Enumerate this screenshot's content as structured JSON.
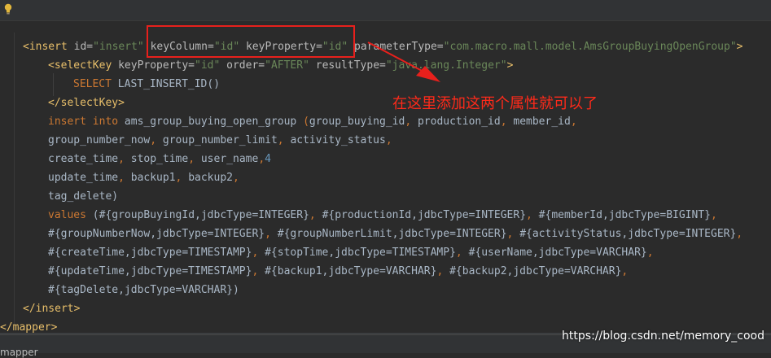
{
  "editor": {
    "lines": [
      [
        {
          "c": "tag",
          "t": "<insert "
        },
        {
          "c": "attr",
          "t": "id="
        },
        {
          "c": "str",
          "t": "\"insert\" "
        },
        {
          "c": "attr",
          "t": "keyColumn="
        },
        {
          "c": "str",
          "t": "\"id\" "
        },
        {
          "c": "attr",
          "t": "keyProperty="
        },
        {
          "c": "str",
          "t": "\"id\" "
        },
        {
          "c": "attr",
          "t": "parameterType="
        },
        {
          "c": "str",
          "t": "\"com.macro.mall.model.AmsGroupBuyingOpenGroup\""
        },
        {
          "c": "tag",
          "t": ">"
        }
      ],
      [
        {
          "c": "tag",
          "t": "<selectKey "
        },
        {
          "c": "attr",
          "t": "keyProperty="
        },
        {
          "c": "str",
          "t": "\"id\" "
        },
        {
          "c": "attr",
          "t": "order="
        },
        {
          "c": "str",
          "t": "\"AFTER\" "
        },
        {
          "c": "attr",
          "t": "resultType="
        },
        {
          "c": "str",
          "t": "\"java.lang.Integer\""
        },
        {
          "c": "tag",
          "t": ">"
        }
      ],
      [
        {
          "c": "kw",
          "t": "SELECT "
        },
        {
          "c": "plain",
          "t": "LAST_INSERT_ID()"
        }
      ],
      [
        {
          "c": "tag",
          "t": "</selectKey>"
        }
      ],
      [
        {
          "c": "kw",
          "t": "insert into "
        },
        {
          "c": "plain",
          "t": "ams_group_buying_open_group "
        },
        {
          "c": "kw",
          "t": "("
        },
        {
          "c": "plain",
          "t": "group_buying_id"
        },
        {
          "c": "kw",
          "t": ", "
        },
        {
          "c": "plain",
          "t": "production_id"
        },
        {
          "c": "kw",
          "t": ", "
        },
        {
          "c": "plain",
          "t": "member_id"
        },
        {
          "c": "kw",
          "t": ","
        }
      ],
      [
        {
          "c": "plain",
          "t": "group_number_now"
        },
        {
          "c": "kw",
          "t": ", "
        },
        {
          "c": "plain",
          "t": "group_number_limit"
        },
        {
          "c": "kw",
          "t": ", "
        },
        {
          "c": "plain",
          "t": "activity_status"
        },
        {
          "c": "kw",
          "t": ","
        }
      ],
      [
        {
          "c": "plain",
          "t": "create_time"
        },
        {
          "c": "kw",
          "t": ", "
        },
        {
          "c": "plain",
          "t": "stop_time"
        },
        {
          "c": "kw",
          "t": ", "
        },
        {
          "c": "plain",
          "t": "user_name"
        },
        {
          "c": "kw",
          "t": ","
        },
        {
          "c": "num",
          "t": "4"
        }
      ],
      [
        {
          "c": "plain",
          "t": "update_time"
        },
        {
          "c": "kw",
          "t": ", "
        },
        {
          "c": "plain",
          "t": "backup1"
        },
        {
          "c": "kw",
          "t": ", "
        },
        {
          "c": "plain",
          "t": "backup2"
        },
        {
          "c": "kw",
          "t": ","
        }
      ],
      [
        {
          "c": "plain",
          "t": "tag_delete)"
        }
      ],
      [
        {
          "c": "kw",
          "t": "values "
        },
        {
          "c": "plain",
          "t": "(#{groupBuyingId,jdbcType=INTEGER}"
        },
        {
          "c": "kw",
          "t": ", "
        },
        {
          "c": "plain",
          "t": "#{productionId,jdbcType=INTEGER}"
        },
        {
          "c": "kw",
          "t": ", "
        },
        {
          "c": "plain",
          "t": "#{memberId,jdbcType=BIGINT}"
        },
        {
          "c": "kw",
          "t": ","
        }
      ],
      [
        {
          "c": "plain",
          "t": "#{groupNumberNow,jdbcType=INTEGER}"
        },
        {
          "c": "kw",
          "t": ", "
        },
        {
          "c": "plain",
          "t": "#{groupNumberLimit,jdbcType=INTEGER}"
        },
        {
          "c": "kw",
          "t": ", "
        },
        {
          "c": "plain",
          "t": "#{activityStatus,jdbcType=INTEGER}"
        },
        {
          "c": "kw",
          "t": ","
        }
      ],
      [
        {
          "c": "plain",
          "t": "#{createTime,jdbcType=TIMESTAMP}"
        },
        {
          "c": "kw",
          "t": ", "
        },
        {
          "c": "plain",
          "t": "#{stopTime,jdbcType=TIMESTAMP}"
        },
        {
          "c": "kw",
          "t": ", "
        },
        {
          "c": "plain",
          "t": "#{userName,jdbcType=VARCHAR}"
        },
        {
          "c": "kw",
          "t": ","
        }
      ],
      [
        {
          "c": "plain",
          "t": "#{updateTime,jdbcType=TIMESTAMP}"
        },
        {
          "c": "kw",
          "t": ", "
        },
        {
          "c": "plain",
          "t": "#{backup1,jdbcType=VARCHAR}"
        },
        {
          "c": "kw",
          "t": ", "
        },
        {
          "c": "plain",
          "t": "#{backup2,jdbcType=VARCHAR}"
        },
        {
          "c": "kw",
          "t": ","
        }
      ],
      [
        {
          "c": "plain",
          "t": "#{tagDelete,jdbcType=VARCHAR})"
        }
      ],
      [
        {
          "c": "tag",
          "t": "</insert>"
        }
      ],
      [
        {
          "c": "tag",
          "t": "</mapper>"
        }
      ]
    ]
  },
  "annotation": {
    "text": "在这里添加这两个属性就可以了",
    "color": "#ff2a1a"
  },
  "breadcrumb": "mapper",
  "watermark": "https://blog.csdn.net/memory_cood",
  "icons": [
    "lightbulb-icon"
  ]
}
